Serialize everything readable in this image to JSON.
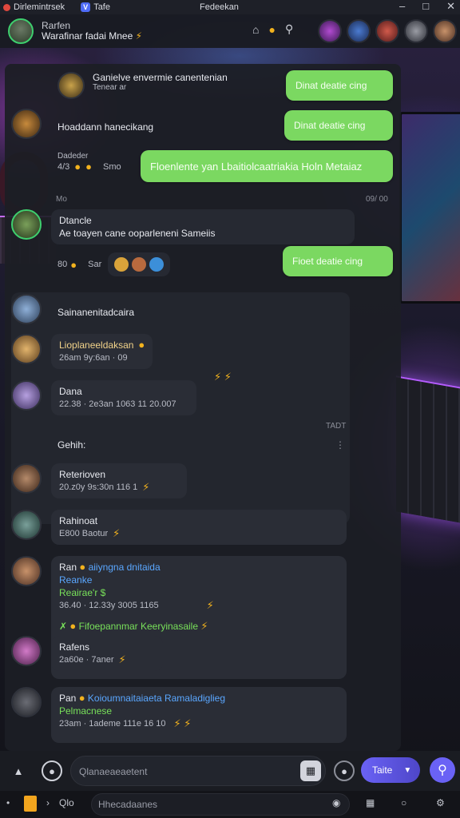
{
  "topbar": {
    "app_title": "Dirlemintrsek",
    "tab_label": "Tafe",
    "window_name": "Fedeekan"
  },
  "header": {
    "name": "Rarfen",
    "subtitle": "Warafinar fadai Mnee"
  },
  "messages_top": [
    {
      "text": "Ganielve envermie canentenian",
      "meta": "Tenear ar"
    },
    {
      "text": "Hoaddann hanecikang"
    },
    {
      "name": "Dadeder",
      "meta": "4/3",
      "extra": "Smo"
    },
    {
      "label": "Mo",
      "time_right": "09/ 00"
    },
    {
      "name": "Dtancle",
      "text": "Ae toayen cane ooparleneni Sameiis"
    },
    {
      "meta": "80",
      "extra": "Sar"
    }
  ],
  "green_bubbles": [
    "Dinat deatie cing",
    "Dinat deatie cing",
    "Floenlente yan Lbaitiolcaatriakia Holn Metaiaz",
    "Fioet deatie cing"
  ],
  "messages_main": [
    {
      "name": "Sainanenitadcaira"
    },
    {
      "name": "Lioplaneeldaksan",
      "meta": "26am 9y:6an · 09",
      "style": "yellow"
    },
    {
      "name": "Dana",
      "meta": "22.38 · 2e3an 1063 11 20.007"
    },
    {
      "section": "Gehih:",
      "tiny": "TADT"
    },
    {
      "name": "Reterioven",
      "meta": "20.z0y 9s:30n 116 1"
    },
    {
      "name": "Rahinoat",
      "meta": "E800 Baotur"
    },
    {
      "name": "Ran",
      "name_highlight": "aiiyngna dnitaida",
      "line2": "Reanke",
      "line3": "Reairae'r $",
      "meta": "36.40 · 12.33y 3005 1165",
      "green_line": "Fifoepannmar Keeryinasaile"
    },
    {
      "name": "Rafens",
      "meta": "2a60e · 7aner"
    },
    {
      "name": "Pan",
      "name_highlight": "Koioumnaitaiaeta Ramaladiglieg",
      "line2": "Pelmacnese",
      "meta": "23am · 1ademe 111e 16 10"
    }
  ],
  "composer": {
    "placeholder": "Qlanaeaeaetent",
    "send_label": "Taite"
  },
  "bottombar": {
    "left_text": "Qlo",
    "search_placeholder": "Hhecadaanes"
  },
  "colors": {
    "accent": "#6a62f5",
    "green_bubble": "#7bd861",
    "online": "#3ecf6e",
    "highlight_blue": "#5aa7ff",
    "highlight_green": "#78e05a",
    "emoji_yellow": "#f2b21e"
  }
}
